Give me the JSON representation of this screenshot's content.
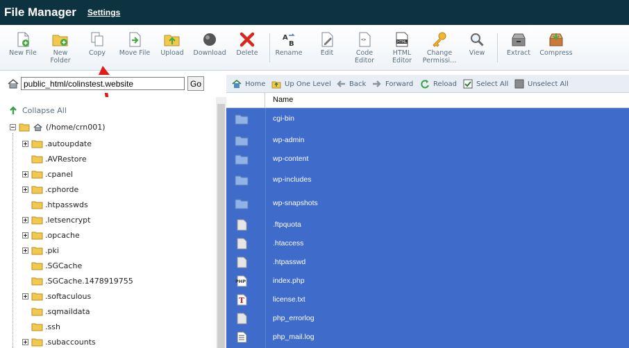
{
  "header": {
    "title": "File Manager",
    "settings_link": "Settings"
  },
  "toolbar": {
    "buttons": [
      {
        "label": "New File",
        "icon": "new-file-icon"
      },
      {
        "label": "New\nFolder",
        "icon": "new-folder-icon"
      },
      {
        "label": "Copy",
        "icon": "copy-icon"
      },
      {
        "label": "Move File",
        "icon": "move-file-icon"
      },
      {
        "label": "Upload",
        "icon": "upload-icon"
      },
      {
        "label": "Download",
        "icon": "download-icon"
      },
      {
        "label": "Delete",
        "icon": "delete-icon"
      },
      {
        "label": "Rename",
        "icon": "rename-icon"
      },
      {
        "label": "Edit",
        "icon": "edit-icon"
      },
      {
        "label": "Code\nEditor",
        "icon": "code-editor-icon"
      },
      {
        "label": "HTML\nEditor",
        "icon": "html-editor-icon"
      },
      {
        "label": "Change\nPermissi...",
        "icon": "permissions-icon"
      },
      {
        "label": "View",
        "icon": "view-icon"
      },
      {
        "label": "Extract",
        "icon": "extract-icon"
      },
      {
        "label": "Compress",
        "icon": "compress-icon"
      }
    ]
  },
  "pathbar": {
    "value": "public_html/colinstest.website",
    "go_label": "Go"
  },
  "nav": {
    "home": "Home",
    "up": "Up One Level",
    "back": "Back",
    "forward": "Forward",
    "reload": "Reload",
    "select_all": "Select All",
    "unselect_all": "Unselect All"
  },
  "tree": {
    "collapse_all": "Collapse All",
    "root": "(/home/crn001)",
    "items": [
      {
        "label": ".autoupdate",
        "expandable": true
      },
      {
        "label": ".AVRestore",
        "expandable": false
      },
      {
        "label": ".cpanel",
        "expandable": true
      },
      {
        "label": ".cphorde",
        "expandable": true
      },
      {
        "label": ".htpasswds",
        "expandable": false
      },
      {
        "label": ".letsencrypt",
        "expandable": true
      },
      {
        "label": ".opcache",
        "expandable": true
      },
      {
        "label": ".pki",
        "expandable": true
      },
      {
        "label": ".SGCache",
        "expandable": false
      },
      {
        "label": ".SGCache.1478919755",
        "expandable": false
      },
      {
        "label": ".softaculous",
        "expandable": true
      },
      {
        "label": ".sqmaildata",
        "expandable": false
      },
      {
        "label": ".ssh",
        "expandable": false
      },
      {
        "label": ".subaccounts",
        "expandable": true
      }
    ]
  },
  "list": {
    "header_name": "Name",
    "rows": [
      {
        "name": "cgi-bin",
        "type": "folder"
      },
      {
        "name": "wp-admin",
        "type": "folder"
      },
      {
        "name": "wp-content",
        "type": "folder"
      },
      {
        "name": "wp-includes",
        "type": "folder"
      },
      {
        "name": "wp-snapshots",
        "type": "folder"
      },
      {
        "name": ".ftpquota",
        "type": "file"
      },
      {
        "name": ".htaccess",
        "type": "file"
      },
      {
        "name": ".htpasswd",
        "type": "file"
      },
      {
        "name": "index.php",
        "type": "php"
      },
      {
        "name": "license.txt",
        "type": "txt"
      },
      {
        "name": "php_errorlog",
        "type": "file"
      },
      {
        "name": "php_mail.log",
        "type": "log"
      }
    ]
  },
  "colors": {
    "header_bg": "#0d3340",
    "selection": "#3f6bcb",
    "toolbar_text": "#5a6f80"
  }
}
